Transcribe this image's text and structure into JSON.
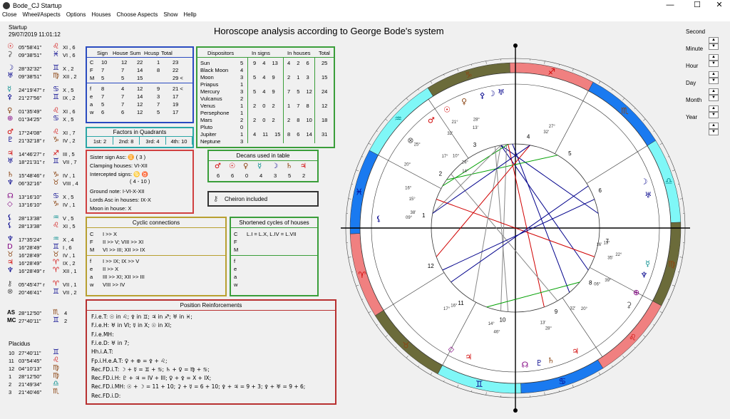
{
  "window": {
    "title": "Bode_CJ Startup",
    "minimize": "—",
    "maximize": "☐",
    "close": "✕"
  },
  "menu": [
    "Close",
    "Wheel/Aspects",
    "Options",
    "Houses",
    "Choose Aspects",
    "Show",
    "Hellp"
  ],
  "header": {
    "name": "Startup",
    "datetime": "29/07/2019 11:01:12",
    "title": "Horoscope analysis according to George Bode's system"
  },
  "planets": [
    {
      "g": "☉",
      "c": "#d00000",
      "pos": "05°58'41\"",
      "sg": "♌",
      "sc": "#d00000",
      "h": "XI , 6"
    },
    {
      "g": "⚳",
      "c": "#555",
      "pos": "09°38'51\"",
      "sg": "♓",
      "sc": "#00008b",
      "h": "VI , 6"
    },
    {
      "g": "☽",
      "c": "#00008b",
      "pos": "28°32'32\"",
      "sg": "♊",
      "sc": "#00008b",
      "h": "X , 2"
    },
    {
      "g": "♅",
      "c": "#00008b",
      "pos": "09°38'51\"",
      "sg": "♍",
      "sc": "#8b4513",
      "h": "XII , 2"
    },
    {
      "g": "☿",
      "c": "#008b8b",
      "pos": "24°19'47\" r",
      "sg": "♋",
      "sc": "#00008b",
      "h": "X , 5"
    },
    {
      "g": "⚴",
      "c": "#00008b",
      "pos": "21°27'56\"",
      "sg": "♊",
      "sc": "#00008b",
      "h": "IX , 2"
    },
    {
      "g": "♀",
      "c": "#8b4513",
      "pos": "01°35'49\"",
      "sg": "♌",
      "sc": "#d00000",
      "h": "XI , 6"
    },
    {
      "g": "⊕",
      "c": "#800080",
      "pos": "01°34'25\"",
      "sg": "♋",
      "sc": "#00008b",
      "h": "X , 5"
    },
    {
      "g": "♂",
      "c": "#d00000",
      "pos": "17°24'08\"",
      "sg": "♌",
      "sc": "#d00000",
      "h": "XI , 7"
    },
    {
      "g": "♇",
      "c": "#00008b",
      "pos": "21°32'18\" r",
      "sg": "♑",
      "sc": "#8b4513",
      "h": "IV , 2"
    },
    {
      "g": "♃",
      "c": "#d00000",
      "pos": "14°46'27\" r",
      "sg": "♐",
      "sc": "#d00000",
      "h": "III , 5"
    },
    {
      "g": "♅",
      "c": "#00008b",
      "pos": "18°21'31\" r",
      "sg": "♊",
      "sc": "#00008b",
      "h": "VII , 7"
    },
    {
      "g": "♄",
      "c": "#8b4513",
      "pos": "15°48'46\" r",
      "sg": "♑",
      "sc": "#8b4513",
      "h": "IV , 1"
    },
    {
      "g": "♆",
      "c": "#00008b",
      "pos": "06°32'16\"",
      "sg": "♉",
      "sc": "#8b4513",
      "h": "VIII , 4"
    },
    {
      "g": "☊",
      "c": "#800080",
      "pos": "13°16'10\"",
      "sg": "♋",
      "sc": "#00008b",
      "h": "X , 5"
    },
    {
      "g": "◇",
      "c": "#800080",
      "pos": "13°16'10\"",
      "sg": "♑",
      "sc": "#8b4513",
      "h": "IV , 1"
    },
    {
      "g": "⚸",
      "c": "#00008b",
      "pos": "28°13'38\"",
      "sg": "♒",
      "sc": "#008b8b",
      "h": "V , 5"
    },
    {
      "g": "⚸",
      "c": "#00008b",
      "pos": "28°13'38\"",
      "sg": "♌",
      "sc": "#d00000",
      "h": "XI , 5"
    },
    {
      "g": "♆",
      "c": "#00008b",
      "pos": "17°35'24\"",
      "sg": "♒",
      "sc": "#008b8b",
      "h": "X , 4"
    },
    {
      "g": "D",
      "c": "#800080",
      "pos": "16°28'49\"",
      "sg": "♊",
      "sc": "#00008b",
      "h": "I , 6"
    },
    {
      "g": "♉",
      "c": "#8b4513",
      "pos": "16°28'49\"",
      "sg": "♉",
      "sc": "#8b4513",
      "h": "IV , 1"
    },
    {
      "g": "♃",
      "c": "#d00000",
      "pos": "16°28'49\"",
      "sg": "♈",
      "sc": "#d00000",
      "h": "IX , 2"
    },
    {
      "g": "♆",
      "c": "#00008b",
      "pos": "16°28'49\" r",
      "sg": "♈",
      "sc": "#d00000",
      "h": "XII , 1"
    },
    {
      "g": "⚷",
      "c": "#555",
      "pos": "05°45'47\" r",
      "sg": "♈",
      "sc": "#d00000",
      "h": "VII , 1"
    },
    {
      "g": "⊗",
      "c": "#555",
      "pos": "20°46'41\"",
      "sg": "♊",
      "sc": "#00008b",
      "h": "VII , 2"
    }
  ],
  "angles": [
    {
      "g": "AS",
      "pos": "28°12'50\"",
      "sg": "♏",
      "sc": "#8b4513",
      "h": "4"
    },
    {
      "g": "MC",
      "pos": "27°40'11\"",
      "sg": "♊",
      "sc": "#00008b",
      "h": "2"
    }
  ],
  "placidus": {
    "title": "Placidus",
    "rows": [
      {
        "n": "10",
        "pos": "27°40'11\"",
        "sg": "♊",
        "sc": "#00008b"
      },
      {
        "n": "11",
        "pos": "03°54'45\"",
        "sg": "♌",
        "sc": "#d00000"
      },
      {
        "n": "12",
        "pos": "04°10'13\"",
        "sg": "♍",
        "sc": "#8b4513"
      },
      {
        "n": "1",
        "pos": "28°12'50\"",
        "sg": "♍",
        "sc": "#8b4513"
      },
      {
        "n": "2",
        "pos": "21°49'34\"",
        "sg": "♎",
        "sc": "#008b8b"
      },
      {
        "n": "3",
        "pos": "21°40'46\"",
        "sg": "♏",
        "sc": "#8b4513"
      }
    ]
  },
  "sign_table": {
    "headers": [
      "Sign",
      "House",
      "Sum",
      "Hcusp",
      "Total"
    ],
    "rows1": [
      [
        "C",
        "10",
        "12",
        "22",
        "1",
        "23"
      ],
      [
        "F",
        "7",
        "7",
        "14",
        "8",
        "22"
      ],
      [
        "M",
        "5",
        "5",
        "15",
        "",
        "29 <"
      ]
    ],
    "rows2": [
      [
        "f",
        "8",
        "4",
        "12",
        "9",
        "21 <"
      ],
      [
        "e",
        "7",
        "7",
        "14",
        "3",
        "17"
      ],
      [
        "a",
        "5",
        "7",
        "12",
        "7",
        "19"
      ],
      [
        "w",
        "6",
        "6",
        "12",
        "5",
        "17"
      ]
    ]
  },
  "dispositors": {
    "headers": [
      "Dispositors",
      "In signs",
      "In houses",
      "Total"
    ],
    "names": [
      "Sun",
      "Black Moon",
      "Moon",
      "Priapus",
      "Mercury",
      "Vulcanus",
      "Venus",
      "Persephone",
      "Mars",
      "Pluto",
      "Jupiter",
      "Neptune"
    ],
    "nums": [
      "5",
      "4",
      "3",
      "1",
      "3",
      "2",
      "1",
      "1",
      "2",
      "0",
      "1",
      "3"
    ],
    "sign_rows": [
      "9 4 13",
      "",
      "5 4 9",
      "",
      "5 4 9",
      "",
      "2 0 2",
      "",
      "2 0 2",
      "",
      "4 11 15",
      ""
    ],
    "house_rows": [
      "4 2 6",
      "",
      "2 1 3",
      "",
      "7 5 12",
      "",
      "1 7 8",
      "",
      "2 8 10",
      "",
      "8 6 14",
      ""
    ],
    "totals": [
      "25",
      "",
      "15",
      "",
      "24",
      "",
      "12",
      "",
      "18",
      "",
      "31",
      ""
    ]
  },
  "quadrants": {
    "title": "Factors in Quadrants",
    "cells": [
      "1st: 2",
      "2nd: 8",
      "3rd: 4",
      "4th: 10"
    ]
  },
  "sister": {
    "lines": [
      "Sister sign Asc:  ♊  ( 3 )",
      "Clamping houses:  VI-XII",
      "Intercepted signs:  ♋ ♉",
      "( 4 - 10 )",
      "Ground note:  I-VI-X-XII",
      "Lords Asc in houses:  IX-X",
      "Moon in house:  X"
    ]
  },
  "decans": {
    "title": "Decans used in table",
    "glyphs": [
      "♂",
      "☉",
      "♀",
      "☿",
      "☽",
      "♄",
      "♃"
    ],
    "colors": [
      "#d00000",
      "#d00000",
      "#8b4513",
      "#008b8b",
      "#00008b",
      "#8b4513",
      "#d00000"
    ],
    "values": [
      "6",
      "6",
      "0",
      "4",
      "3",
      "5",
      "2"
    ]
  },
  "cheiron": {
    "label": "Cheiron included"
  },
  "cyclic": {
    "title": "Cyclic connections",
    "rows": [
      [
        "C",
        "I >> X"
      ],
      [
        "F",
        "II >> V;  VIII >> XI"
      ],
      [
        "M",
        "VI >> III;  XII >> IX"
      ],
      [
        "f",
        "I >> IX;  IX >> V"
      ],
      [
        "e",
        "II >> X"
      ],
      [
        "a",
        "III >> XI;  XII >> III"
      ],
      [
        "w",
        "VIII >> IV"
      ]
    ]
  },
  "shortened": {
    "title": "Shortened cycles of houses",
    "rows": [
      [
        "C",
        "L.I = L.X,  L.IV = L.VII"
      ],
      [
        "F",
        ""
      ],
      [
        "M",
        ""
      ],
      [
        "f",
        ""
      ],
      [
        "e",
        ""
      ],
      [
        "a",
        ""
      ],
      [
        "w",
        ""
      ]
    ]
  },
  "reinforce": {
    "title": "Position Reinforcements",
    "rows": [
      "F.i.e.T: ☉ in ♌;  ⚴ in ♊;  ♃ in ♐;  ♅ in ♓;",
      "F.i.e.H: ♅ in VI;  ☿ in X;  ☉ in XI;",
      "F.i.e.MH:",
      "F.i.e.D: ♅ in 7;",
      "Hh.i.A.T:",
      "Fp.i.H.e.A.T: ♀ + ⊕ = ⚴ + ♌;",
      "Rec.FD.i.T: ☽ + ☿ = ♊ + ♋;  ♄ + ♀ = ♍ + ♋;",
      "Rec.FD.i.H: ♇ + ♃ = IV + III;  ♀ + ⚴ = X + IX;",
      "Rec.FD.i.MH: ☉ + ☽ = 11 + 10;  ⚳ + ☿ = 6 + 10;  ⚴ + ♃ = 9 + 3;  ⚴ + ♅ = 9 + 6;",
      "Rec.FD.i.D:"
    ]
  },
  "side": {
    "items": [
      "Second",
      "Minute",
      "Hour",
      "Day",
      "Month",
      "Year"
    ]
  },
  "wheel": {
    "house_numbers": [
      "1",
      "2",
      "3",
      "4",
      "5",
      "6",
      "7",
      "8",
      "9",
      "10",
      "11",
      "12"
    ],
    "signs": [
      "♈",
      "♉",
      "♊",
      "♋",
      "♌",
      "♍",
      "♎",
      "♏",
      "♐",
      "♑",
      "♒",
      "♓"
    ],
    "sign_colors": [
      "#d00000",
      "#8b4513",
      "#00008b",
      "#00008b",
      "#d00000",
      "#8b4513",
      "#008b8b",
      "#8b4513",
      "#d00000",
      "#8b4513",
      "#008b8b",
      "#00008b"
    ],
    "deg_labels": [
      "27°",
      "32'",
      "28°",
      "13'",
      "21°",
      "32'",
      "16°",
      "15°",
      "20°",
      "25°",
      "09°",
      "38'",
      "17°",
      "10°",
      "24°",
      "14°",
      "22°",
      "35'",
      "39°",
      "06°",
      "20°",
      "32'",
      "28°",
      "13'",
      "46°",
      "14°",
      "17°",
      "16°",
      "13°",
      "16'"
    ]
  },
  "colors": {
    "red": "#d00000",
    "navy": "#00008b",
    "brown": "#8b4513",
    "teal": "#008b8b",
    "purple": "#800080",
    "olive": "#6b6b3a",
    "cyan": "#7ff7f7",
    "blue": "#1a7af0",
    "pink": "#f08080"
  }
}
